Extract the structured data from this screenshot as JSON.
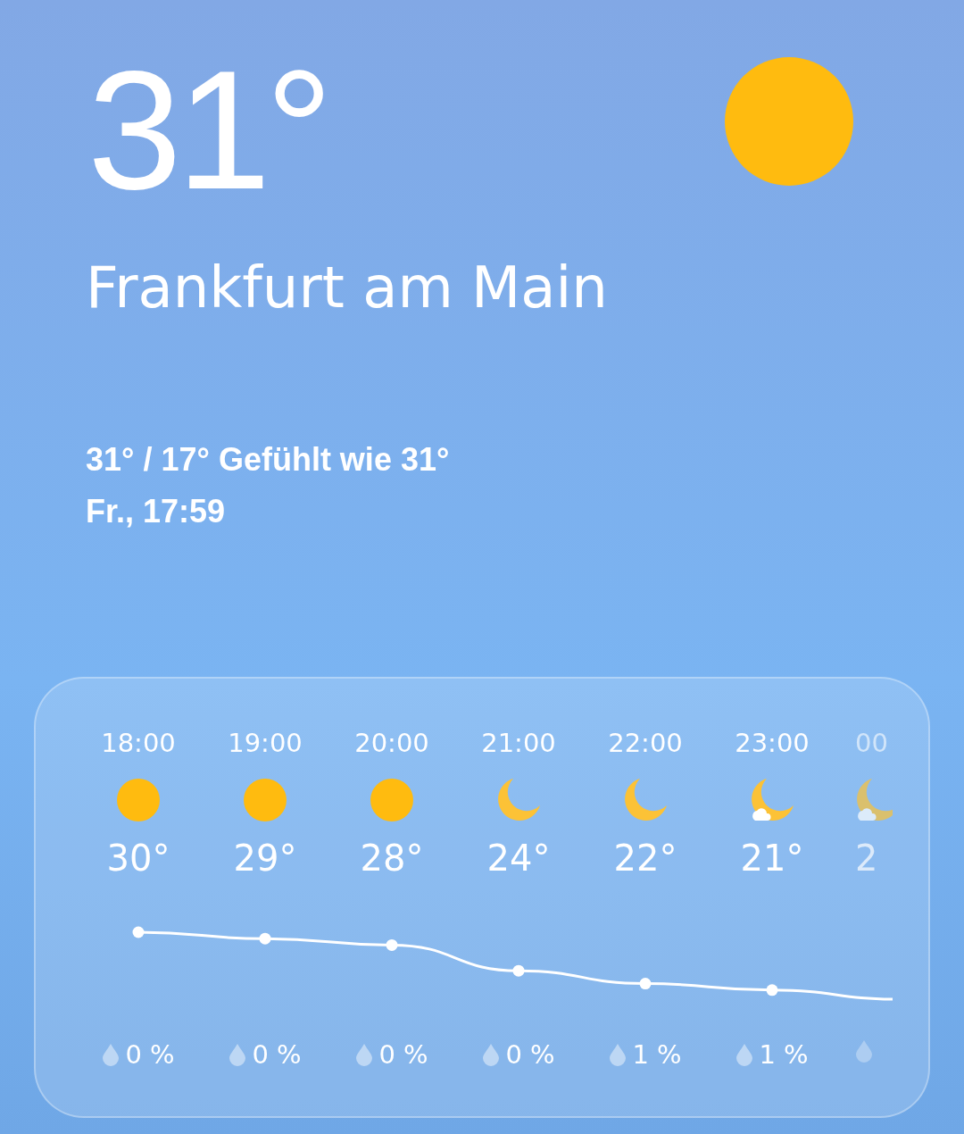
{
  "current": {
    "temperature": "31°",
    "city": "Frankfurt am Main",
    "range": "31° / 17° Gefühlt wie 31°",
    "datetime": "Fr., 17:59",
    "kind": "sun"
  },
  "hourly": [
    {
      "time": "18:00",
      "kind": "sun",
      "temp": "30°",
      "precip": "0 %"
    },
    {
      "time": "19:00",
      "kind": "sun",
      "temp": "29°",
      "precip": "0 %"
    },
    {
      "time": "20:00",
      "kind": "sun",
      "temp": "28°",
      "precip": "0 %"
    },
    {
      "time": "21:00",
      "kind": "moon",
      "temp": "24°",
      "precip": "0 %"
    },
    {
      "time": "22:00",
      "kind": "moon",
      "temp": "22°",
      "precip": "1 %"
    },
    {
      "time": "23:00",
      "kind": "moon-cloud",
      "temp": "21°",
      "precip": "1 %"
    },
    {
      "time": "00",
      "kind": "moon-cloud",
      "temp": "2",
      "partial": true
    }
  ]
}
